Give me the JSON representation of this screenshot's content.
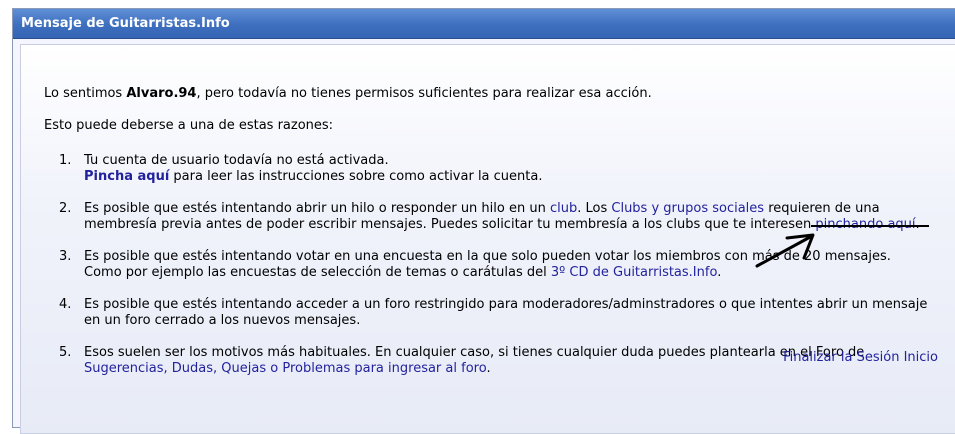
{
  "header": {
    "title": "Mensaje de Guitarristas.Info"
  },
  "intro": {
    "prefix": "Lo sentimos ",
    "username": "Alvaro.94",
    "suffix": ", pero todavía no tienes permisos suficientes para realizar esa acción."
  },
  "reasons_intro": "Esto puede deberse a una de estas razones:",
  "reasons": [
    {
      "number": "1.",
      "line1": "Tu cuenta de usuario todavía no está activada.",
      "link": "Pincha aquí",
      "line2_rest": " para leer las instrucciones sobre como activar la cuenta."
    },
    {
      "number": "2.",
      "line1_prefix": "Es posible que estés intentando abrir un hilo o responder un hilo en un ",
      "club_link": "club",
      "line1_mid": ". Los ",
      "clubs_link": "Clubs y grupos sociales",
      "line1_suffix": " requieren de una",
      "line2_prefix": "membresía previa antes de poder escribir mensajes. Puedes solicitar tu membresía a los clubs que te interesen ",
      "line2_link": "pinchando aquí",
      "line2_suffix": "."
    },
    {
      "number": "3.",
      "line1": "Es posible que estés intentando votar en una encuesta en la que solo pueden votar los miembros con más de 20 mensajes.",
      "line2_prefix": "Como por ejemplo las encuestas de selección de temas o carátulas del ",
      "line2_link": "3º CD de Guitarristas.Info",
      "line2_suffix": "."
    },
    {
      "number": "4.",
      "line1": "Es posible que estés intentando acceder a un foro restringido para moderadores/adminstradores o que intentes abrir un mensaje",
      "line2": "en un foro cerrado a los nuevos mensajes."
    },
    {
      "number": "5.",
      "line1": "Esos suelen ser los motivos más habituales. En cualquier caso, si tienes cualquier duda puedes plantearla en el Foro de",
      "line2_link": "Sugerencias, Dudas, Quejas o Problemas para ingresar al foro",
      "line2_suffix": "."
    }
  ],
  "footer": {
    "logout": "Finalizar la Sesión",
    "home": "Inicio"
  },
  "colors": {
    "header_bg": "#3e6fbf",
    "link": "#22229c",
    "content_bg": "#eef1f9"
  }
}
